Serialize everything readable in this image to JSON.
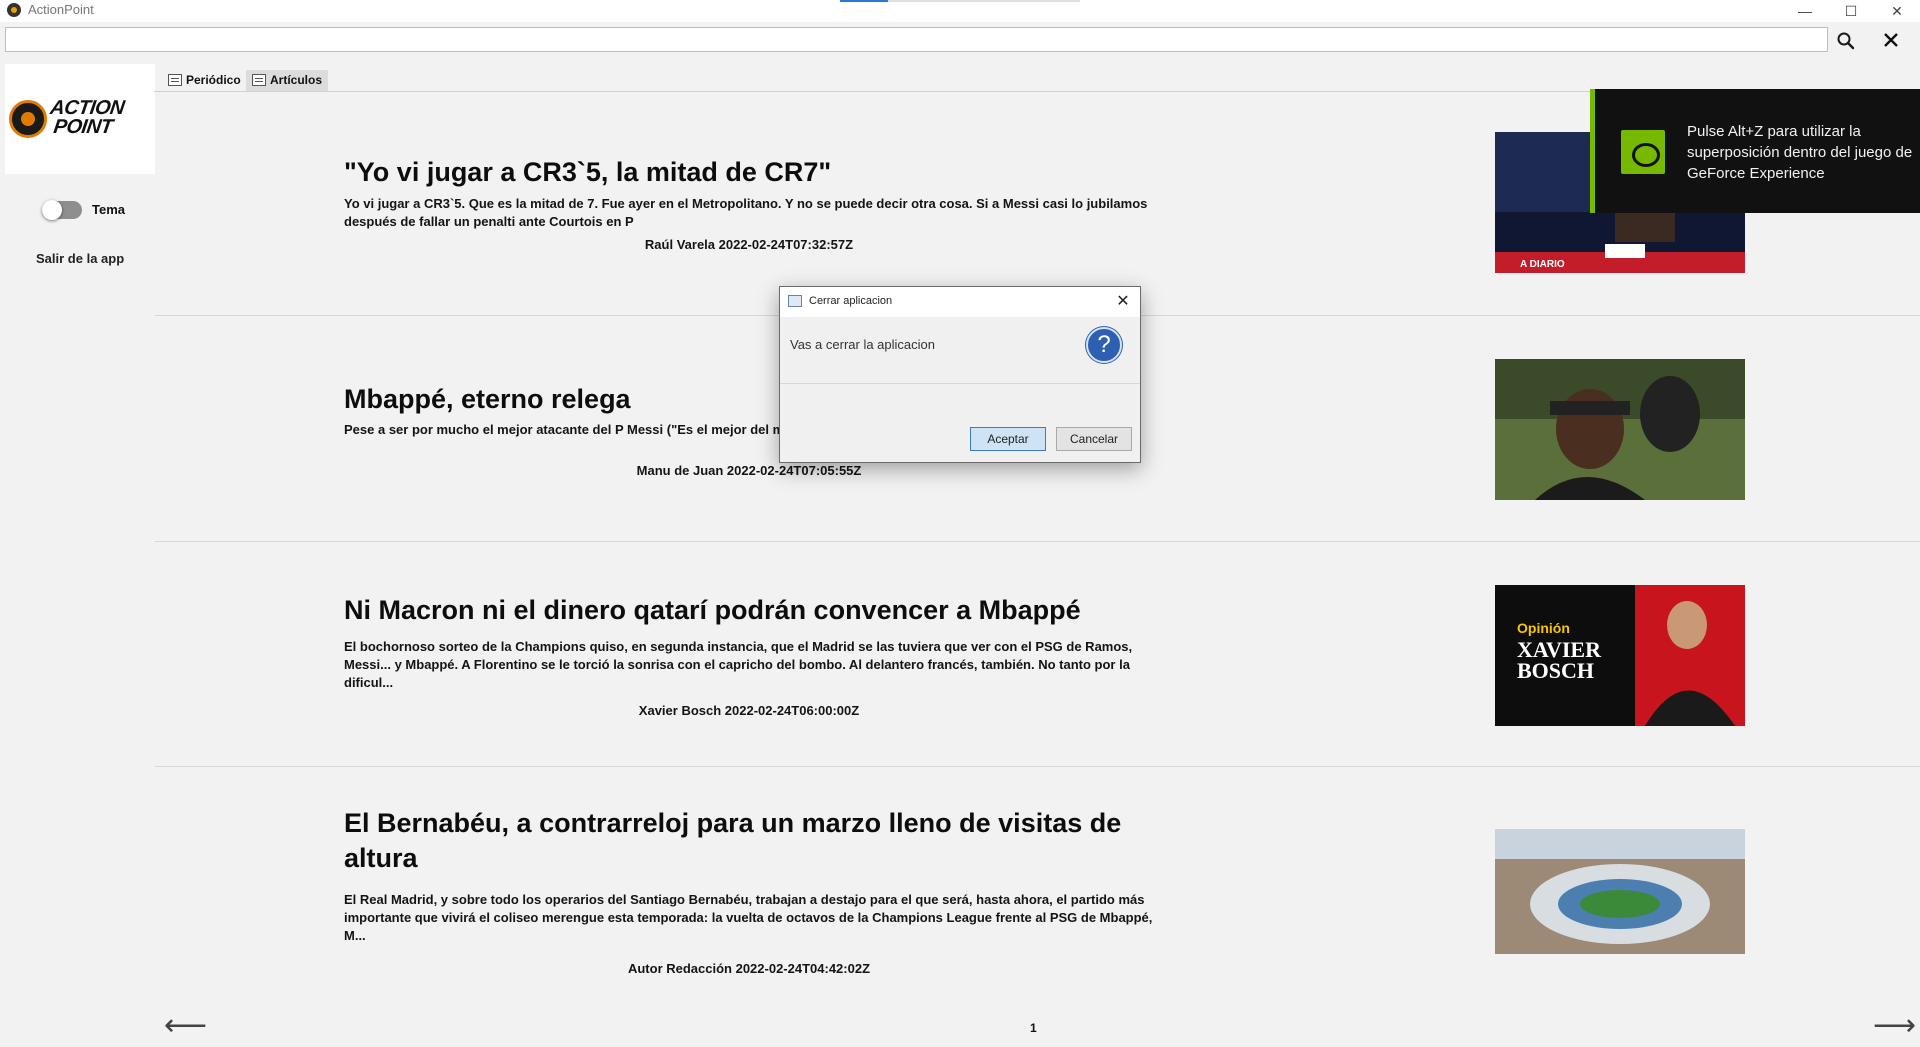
{
  "window": {
    "title": "ActionPoint",
    "minimize_glyph": "—",
    "maximize_glyph": "☐",
    "close_glyph": "✕"
  },
  "search": {
    "value": "",
    "placeholder": ""
  },
  "sidebar": {
    "logo_line1": "ACTION",
    "logo_line2": "POINT",
    "theme_label": "Tema",
    "exit_label": "Salir de la app"
  },
  "tabs": [
    {
      "label": "Periódico"
    },
    {
      "label": "Artículos"
    }
  ],
  "articles": [
    {
      "title": "\"Yo vi jugar a CR3`5, la mitad de CR7\"",
      "summary": "Yo vi jugar a CR3`5. Que es la mitad de 7. Fue ayer en el Metropolitano. Y no se puede decir otra cosa. Si a Messi casi lo jubilamos después de fallar un penalti ante Courtois en P",
      "meta": "Raúl Varela 2022-02-24T07:32:57Z",
      "thumb_caption": "A DIARIO"
    },
    {
      "title": "Mbappé, eterno relega",
      "summary": "Pese a ser por mucho el mejor atacante del P                                                                                 Messi (\"Es el mejor del mundo\") y el PSG le sigue dejando en segund",
      "meta": "Manu de Juan 2022-02-24T07:05:55Z"
    },
    {
      "title": "Ni Macron ni el dinero qatarí podrán convencer a Mbappé",
      "summary": "El bochornoso sorteo de la Champions quiso, en segunda instancia, que el Madrid se las tuviera que ver con el PSG de Ramos, Messi... y Mbappé. A Florentino se le torció la sonrisa con el capricho del bombo. Al delantero francés, también. No tanto por la dificul...",
      "meta": "Xavier Bosch 2022-02-24T06:00:00Z",
      "thumb_opinion": "Opinión",
      "thumb_name1": "XAVIER",
      "thumb_name2": "BOSCH"
    },
    {
      "title": "El Bernabéu, a contrarreloj para un marzo lleno de visitas de altura",
      "summary": "El Real Madrid, y sobre todo los operarios del Santiago Bernabéu, trabajan a destajo para el que será, hasta ahora, el partido más importante que vivirá el coliseo merengue esta temporada: la vuelta de octavos de la Champions League frente al PSG de Mbappé, M...",
      "meta": "Autor Redacción 2022-02-24T04:42:02Z"
    }
  ],
  "pagination": {
    "prev": "⟵",
    "page": "1",
    "next": "⟶"
  },
  "overlay": {
    "text": "Pulse Alt+Z para utilizar la superposición dentro del juego de GeForce Experience",
    "accent": "#76b900"
  },
  "dialog": {
    "title": "Cerrar aplicacion",
    "message": "Vas a cerrar la aplicacion",
    "icon_glyph": "?",
    "ok_label": "Aceptar",
    "cancel_label": "Cancelar",
    "close_glyph": "✕"
  },
  "icons": {
    "app": "actionpoint-logo-icon",
    "search": "magnifier-icon",
    "clear": "close-icon",
    "question": "question-icon"
  }
}
